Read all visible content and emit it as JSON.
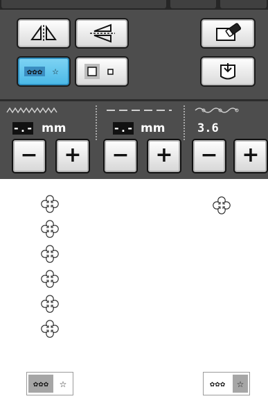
{
  "toolbar": {
    "mirror_horizontal": {
      "icon": "mirror-horizontal-icon"
    },
    "mirror_vertical": {
      "icon": "mirror-vertical-icon"
    },
    "eraser": {
      "icon": "eraser-icon"
    },
    "pattern_repeat": {
      "icon": "pattern-repeat-icon",
      "state": "selected"
    },
    "size_select": {
      "icon": "size-squares-icon"
    },
    "pocket": {
      "icon": "pocket-icon"
    }
  },
  "params": {
    "width": {
      "icon": "stitch-width-icon",
      "value": "-.-",
      "unit": "mm",
      "minus": "−",
      "plus": "+"
    },
    "length": {
      "icon": "stitch-length-icon",
      "value": "-.-",
      "unit": "mm",
      "minus": "−",
      "plus": "+"
    },
    "density": {
      "icon": "stitch-density-icon",
      "value": "3.6",
      "minus": "−",
      "plus": "+"
    }
  },
  "preview": {
    "left_pattern": {
      "icon": "flower-motif-icon",
      "repeat": 6
    },
    "right_pattern": {
      "icon": "flower-motif-icon",
      "repeat": 1
    },
    "left_chip": {
      "icon": "repeat-indicator-icon",
      "highlight": "left"
    },
    "right_chip": {
      "icon": "repeat-indicator-icon",
      "highlight": "right"
    }
  },
  "colors": {
    "panel_bg": "#4d4d4d",
    "accent_active": "#4ab8e6",
    "chip_highlight": "#a6a6a6"
  }
}
